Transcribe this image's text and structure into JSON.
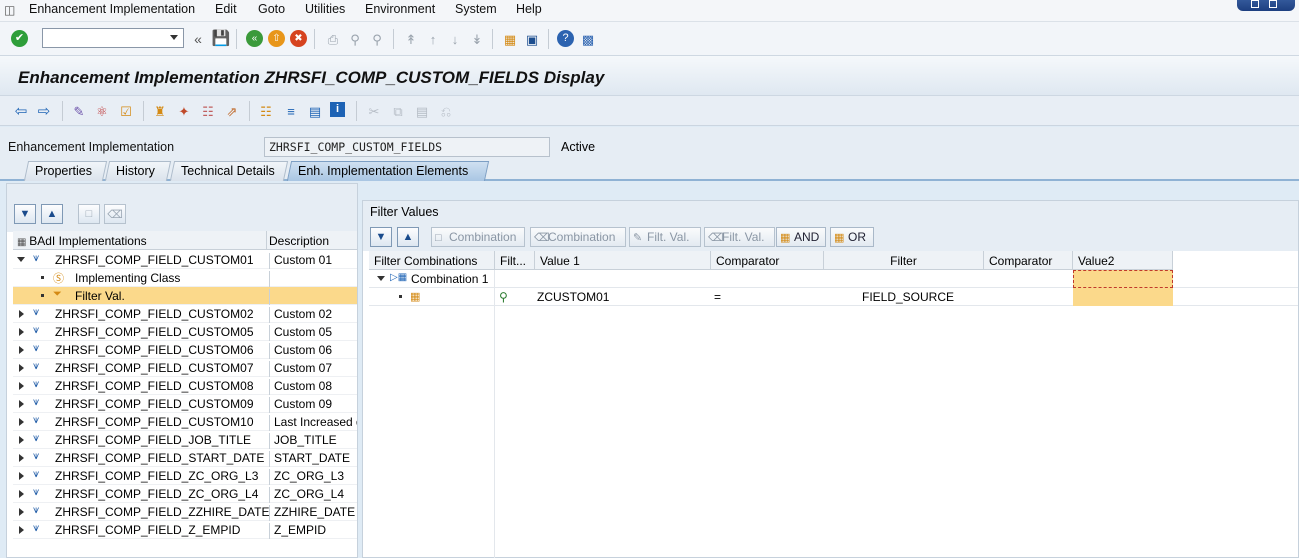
{
  "menubar": {
    "items": [
      {
        "label": "Enhancement Implementation",
        "ul": "E"
      },
      {
        "label": "Edit",
        "ul": "E"
      },
      {
        "label": "Goto",
        "ul": "G"
      },
      {
        "label": "Utilities",
        "ul": "U"
      },
      {
        "label": "Environment",
        "ul": "n"
      },
      {
        "label": "System",
        "ul": "S"
      },
      {
        "label": "Help",
        "ul": "H"
      }
    ],
    "window_controls_color": "#2a4f92"
  },
  "std_toolbar": {
    "command_field_value": "",
    "icons": [
      "enter-icon",
      "save-icon",
      "back-icon",
      "exit-icon",
      "cancel-icon",
      "print-icon",
      "find-icon",
      "find-next-icon",
      "first-page-icon",
      "previous-page-icon",
      "next-page-icon",
      "last-page-icon",
      "new-session-icon",
      "shortcut-icon",
      "help-icon",
      "layout-menu-icon"
    ]
  },
  "title": "Enhancement Implementation ZHRSFI_COMP_CUSTOM_FIELDS Display",
  "header": {
    "label": "Enhancement Implementation",
    "value": "ZHRSFI_COMP_CUSTOM_FIELDS",
    "status": "Active"
  },
  "tabs": [
    {
      "label": "Properties",
      "active": false
    },
    {
      "label": "History",
      "active": false
    },
    {
      "label": "Technical Details",
      "active": false
    },
    {
      "label": "Enh. Implementation Elements",
      "active": true
    }
  ],
  "left_panel": {
    "col_name": "BAdI Implementations",
    "col_desc": "Description",
    "rows": [
      {
        "name": "ZHRSFI_COMP_FIELD_CUSTOM01",
        "desc": "Custom 01",
        "level": 0,
        "expanded": true
      },
      {
        "name": "Implementing Class",
        "desc": "",
        "level": 1,
        "icon": "class"
      },
      {
        "name": "Filter Val.",
        "desc": "",
        "level": 1,
        "icon": "filter",
        "selected": true
      },
      {
        "name": "ZHRSFI_COMP_FIELD_CUSTOM02",
        "desc": "Custom 02",
        "level": 0
      },
      {
        "name": "ZHRSFI_COMP_FIELD_CUSTOM05",
        "desc": "Custom 05",
        "level": 0
      },
      {
        "name": "ZHRSFI_COMP_FIELD_CUSTOM06",
        "desc": "Custom 06",
        "level": 0
      },
      {
        "name": "ZHRSFI_COMP_FIELD_CUSTOM07",
        "desc": "Custom 07",
        "level": 0
      },
      {
        "name": "ZHRSFI_COMP_FIELD_CUSTOM08",
        "desc": "Custom 08",
        "level": 0
      },
      {
        "name": "ZHRSFI_COMP_FIELD_CUSTOM09",
        "desc": "Custom 09",
        "level": 0
      },
      {
        "name": "ZHRSFI_COMP_FIELD_CUSTOM10",
        "desc": "Last Increased d",
        "level": 0
      },
      {
        "name": "ZHRSFI_COMP_FIELD_JOB_TITLE",
        "desc": "JOB_TITLE",
        "level": 0
      },
      {
        "name": "ZHRSFI_COMP_FIELD_START_DATE",
        "desc": "START_DATE",
        "level": 0
      },
      {
        "name": "ZHRSFI_COMP_FIELD_ZC_ORG_L3",
        "desc": "ZC_ORG_L3",
        "level": 0
      },
      {
        "name": "ZHRSFI_COMP_FIELD_ZC_ORG_L4",
        "desc": "ZC_ORG_L4",
        "level": 0
      },
      {
        "name": "ZHRSFI_COMP_FIELD_ZZHIRE_DATE",
        "desc": "ZZHIRE_DATE",
        "level": 0
      },
      {
        "name": "ZHRSFI_COMP_FIELD_Z_EMPID",
        "desc": "Z_EMPID",
        "level": 0
      }
    ]
  },
  "right_panel": {
    "title": "Filter Values",
    "buttons": [
      {
        "label": "Combination",
        "icon": "new-icon",
        "enabled": false
      },
      {
        "label": "Combination",
        "icon": "delete-icon",
        "enabled": false
      },
      {
        "label": "Filt. Val.",
        "icon": "edit-icon",
        "enabled": false
      },
      {
        "label": "Filt. Val.",
        "icon": "delete-icon",
        "enabled": false
      },
      {
        "label": "AND",
        "icon": "and-icon",
        "enabled": true
      },
      {
        "label": "OR",
        "icon": "or-icon",
        "enabled": true
      }
    ],
    "columns": [
      "Filter Combinations",
      "Filt...",
      "Value 1",
      "Comparator",
      "Filter",
      "Comparator",
      "Value2"
    ],
    "combination_label": "Combination 1",
    "row": {
      "value1": "ZCUSTOM01",
      "comparator": "=",
      "filter": "FIELD_SOURCE",
      "comparator2": "",
      "value2": ""
    }
  },
  "colors": {
    "selected_row": "#fbd98b",
    "value2_highlight": "#fbd98b",
    "accent": "#2a4f92"
  }
}
